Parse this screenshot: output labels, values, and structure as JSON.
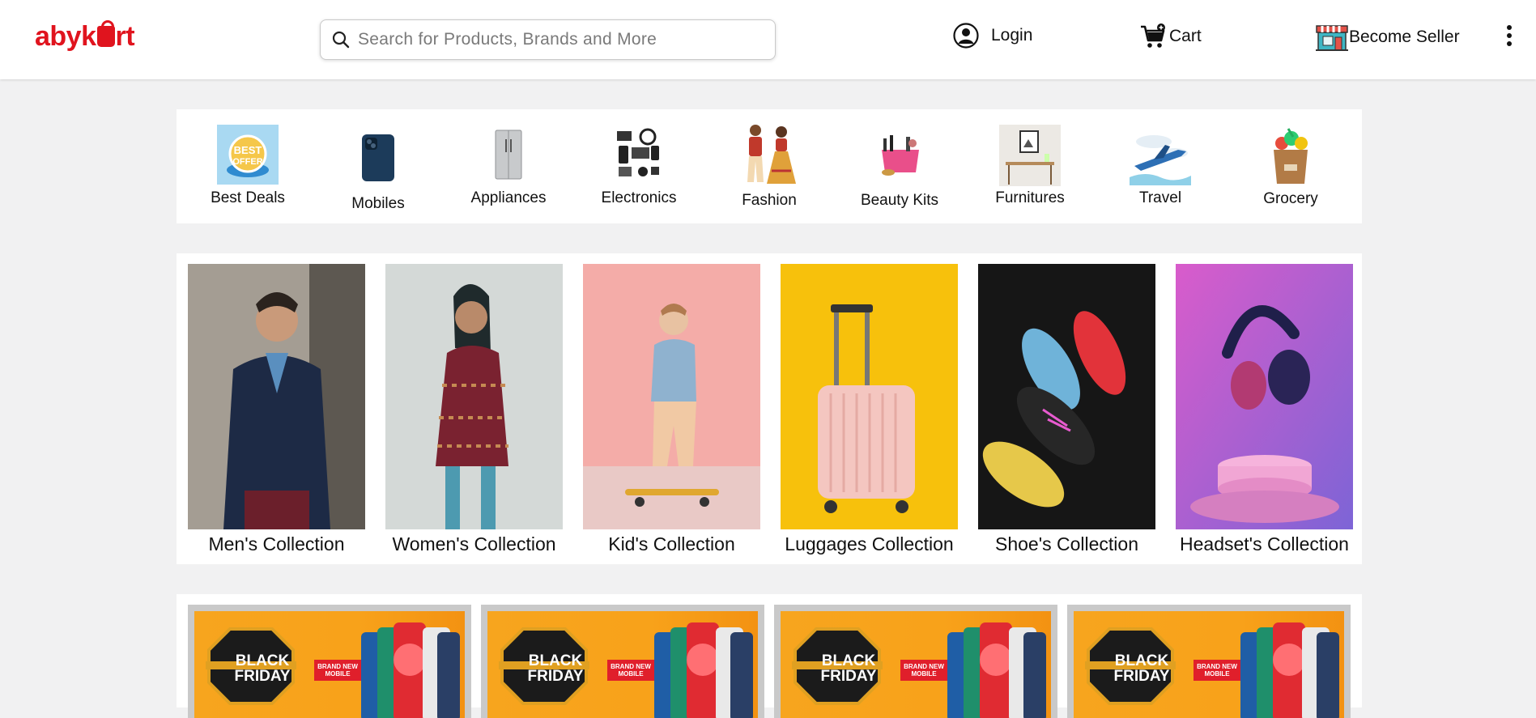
{
  "header": {
    "logo_text_before": "abyk",
    "logo_text_after": "rt",
    "brand_color": "#e0141e",
    "search_placeholder": "Search for Products, Brands and More",
    "login_label": "Login",
    "cart_label": "Cart",
    "seller_label": "Become Seller",
    "icons": [
      "search-icon",
      "user-circle-icon",
      "cart-icon",
      "store-icon",
      "kebab-menu-icon"
    ]
  },
  "categories": [
    {
      "label": "Best Deals",
      "icon": "best-offer-icon"
    },
    {
      "label": "Mobiles",
      "icon": "mobile-phone-icon"
    },
    {
      "label": "Appliances",
      "icon": "refrigerator-icon"
    },
    {
      "label": "Electronics",
      "icon": "electronics-icon"
    },
    {
      "label": "Fashion",
      "icon": "fashion-couple-icon"
    },
    {
      "label": "Beauty Kits",
      "icon": "beauty-kit-icon"
    },
    {
      "label": "Furnitures",
      "icon": "furniture-icon"
    },
    {
      "label": "Travel",
      "icon": "airplane-icon"
    },
    {
      "label": "Grocery",
      "icon": "grocery-bag-icon"
    }
  ],
  "collections": [
    {
      "label": "Men's Collection"
    },
    {
      "label": "Women's Collection"
    },
    {
      "label": "Kid's Collection"
    },
    {
      "label": "Luggages Collection"
    },
    {
      "label": "Shoe's Collection"
    },
    {
      "label": "Headset's Collection"
    }
  ],
  "banners": [
    {
      "headline_line1": "BLACK",
      "headline_line2": "FRIDAY",
      "tag_line1": "BRAND NEW",
      "tag_line2": "MOBILE"
    },
    {
      "headline_line1": "BLACK",
      "headline_line2": "FRIDAY",
      "tag_line1": "BRAND NEW",
      "tag_line2": "MOBILE"
    },
    {
      "headline_line1": "BLACK",
      "headline_line2": "FRIDAY",
      "tag_line1": "BRAND NEW",
      "tag_line2": "MOBILE"
    },
    {
      "headline_line1": "BLACK",
      "headline_line2": "FRIDAY",
      "tag_line1": "BRAND NEW",
      "tag_line2": "MOBILE"
    }
  ]
}
